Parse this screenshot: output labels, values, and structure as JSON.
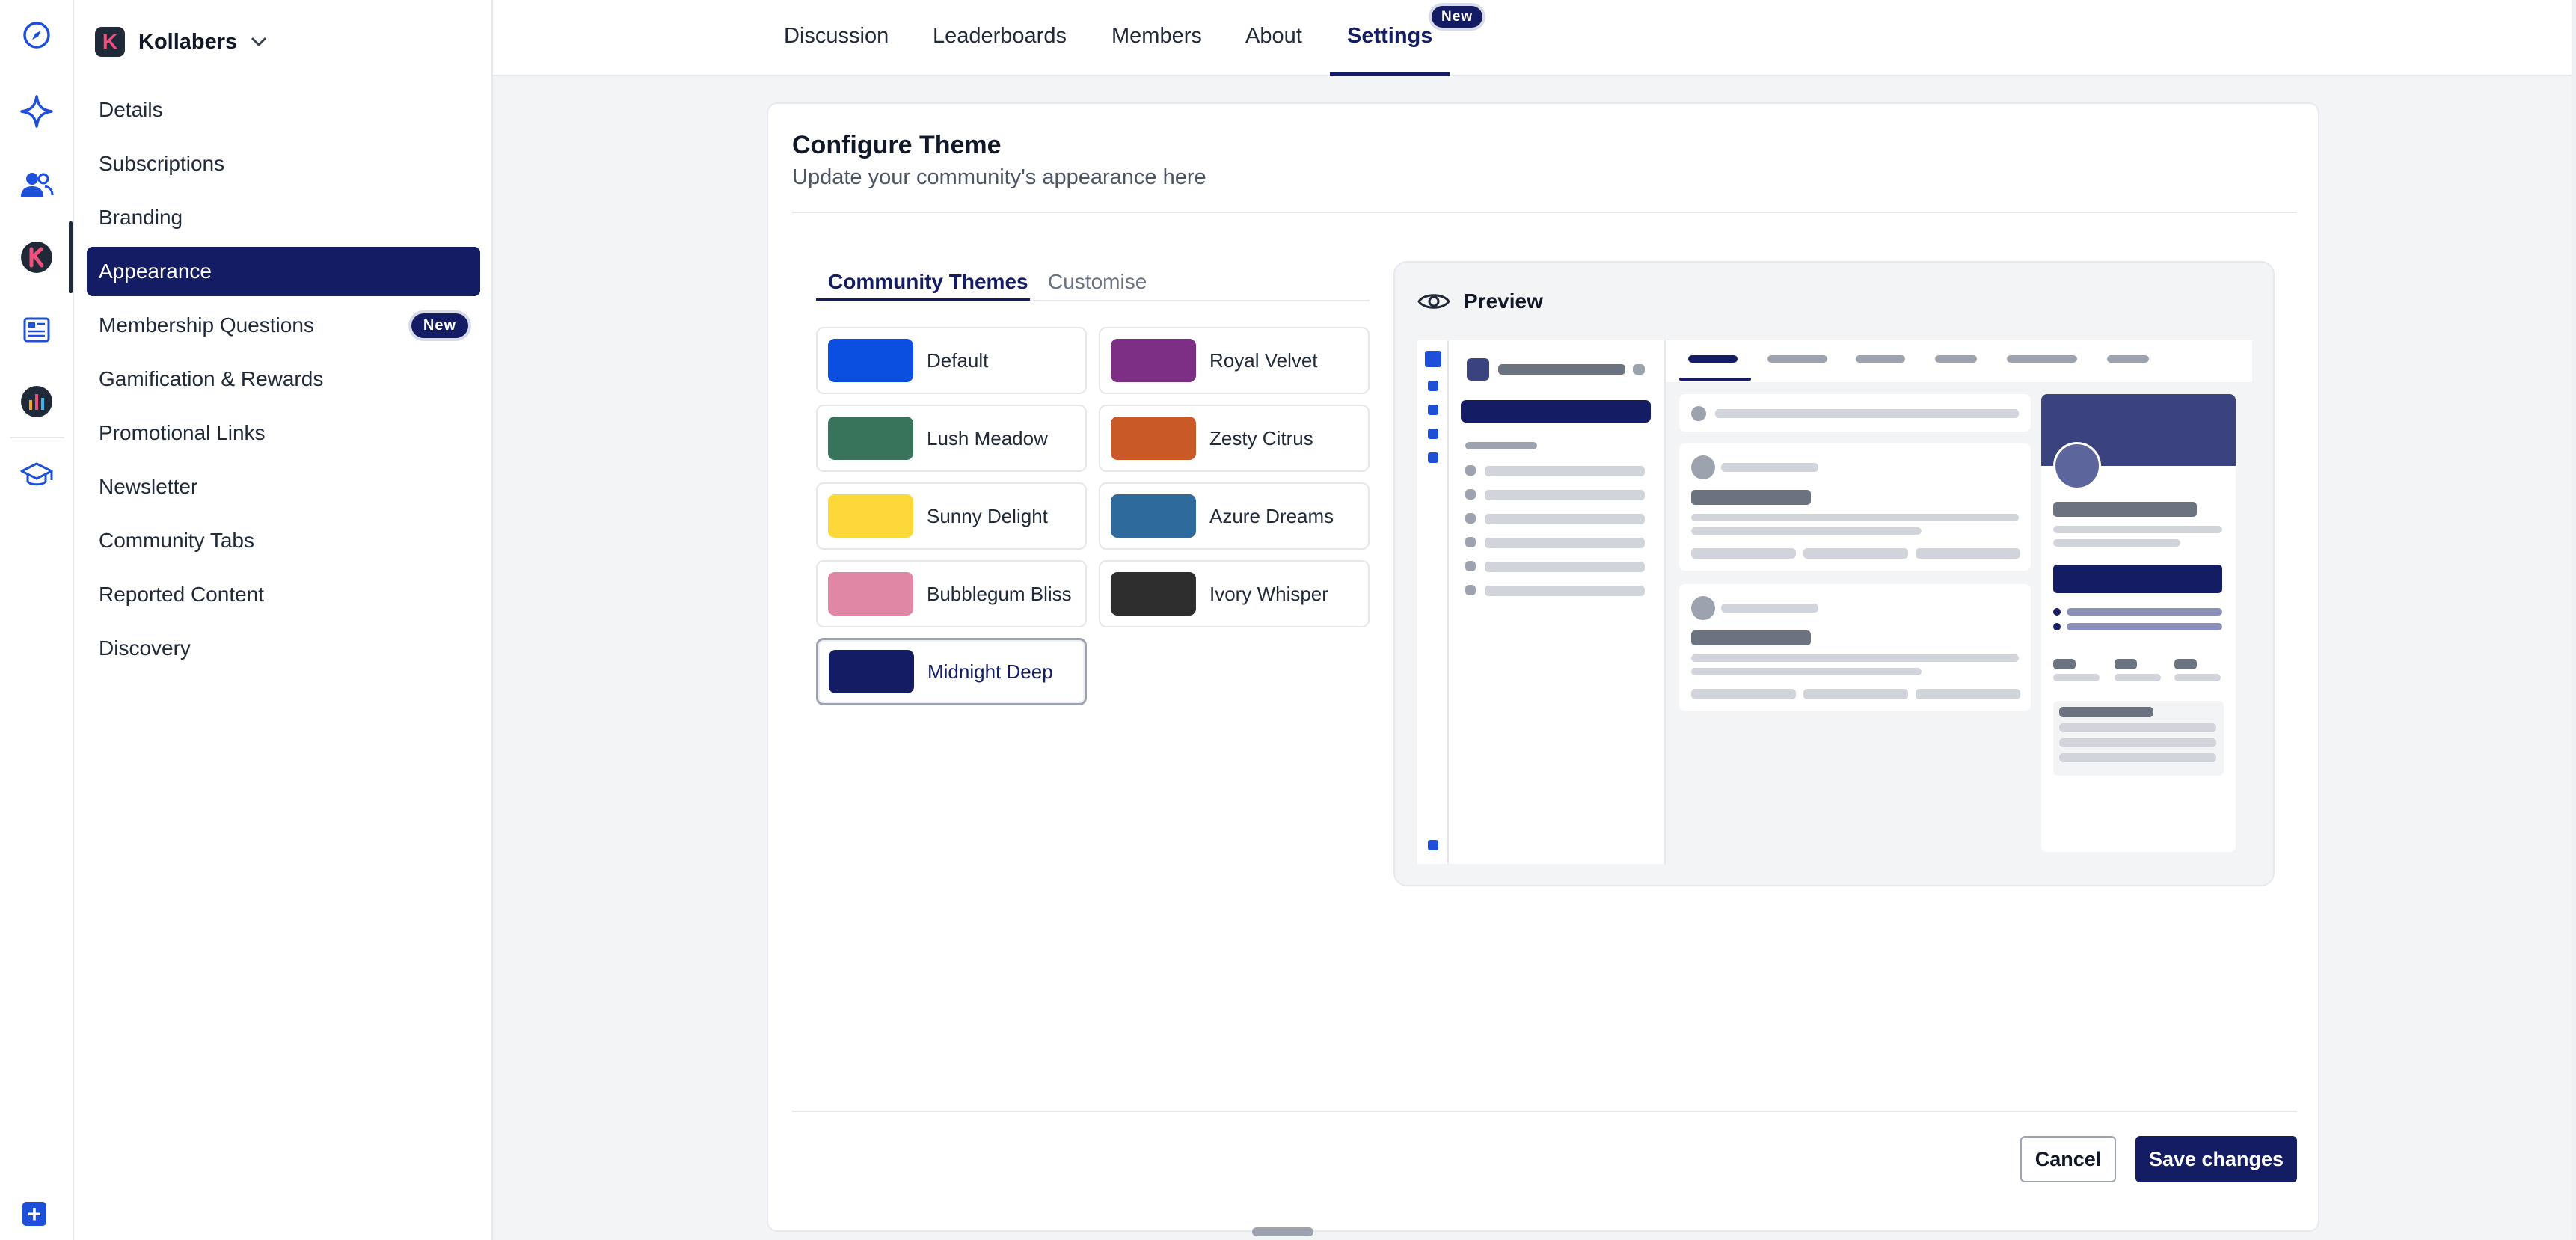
{
  "brand": {
    "name": "Kollabers",
    "logo_letter": "K"
  },
  "rail": {
    "icons": [
      "compass-icon",
      "sparkle-icon",
      "users-icon",
      "community-k-icon",
      "newsletter-icon",
      "leaderboard-app-icon",
      "graduation-cap-icon"
    ],
    "add_icon": "plus-icon"
  },
  "sidebar": {
    "items": [
      {
        "label": "Details"
      },
      {
        "label": "Subscriptions"
      },
      {
        "label": "Branding"
      },
      {
        "label": "Appearance",
        "active": true
      },
      {
        "label": "Membership Questions",
        "badge": "New"
      },
      {
        "label": "Gamification & Rewards"
      },
      {
        "label": "Promotional Links"
      },
      {
        "label": "Newsletter"
      },
      {
        "label": "Community Tabs"
      },
      {
        "label": "Reported Content"
      },
      {
        "label": "Discovery"
      }
    ]
  },
  "tabs": {
    "items": [
      "Discussion",
      "Leaderboards",
      "Members",
      "About",
      "Settings"
    ],
    "active": "Settings",
    "badge": "New"
  },
  "card": {
    "title": "Configure Theme",
    "subtitle": "Update your community's appearance here"
  },
  "subtabs": {
    "community": "Community Themes",
    "customise": "Customise"
  },
  "themes": [
    {
      "name": "Default",
      "color": "#0a4fe0"
    },
    {
      "name": "Royal Velvet",
      "color": "#7d2f86"
    },
    {
      "name": "Lush Meadow",
      "color": "#37745b"
    },
    {
      "name": "Zesty Citrus",
      "color": "#c95a27"
    },
    {
      "name": "Sunny Delight",
      "color": "#fcd938"
    },
    {
      "name": "Azure Dreams",
      "color": "#2e6a9b"
    },
    {
      "name": "Bubblegum Bliss",
      "color": "#e087a6"
    },
    {
      "name": "Ivory Whisper",
      "color": "#2e2e2e"
    },
    {
      "name": "Midnight Deep",
      "color": "#141d63",
      "selected": true
    }
  ],
  "preview": {
    "label": "Preview",
    "icon": "eye-icon"
  },
  "actions": {
    "cancel": "Cancel",
    "save": "Save changes"
  },
  "colors": {
    "accent": "#141d63",
    "brand_blue": "#1d4fd8"
  }
}
